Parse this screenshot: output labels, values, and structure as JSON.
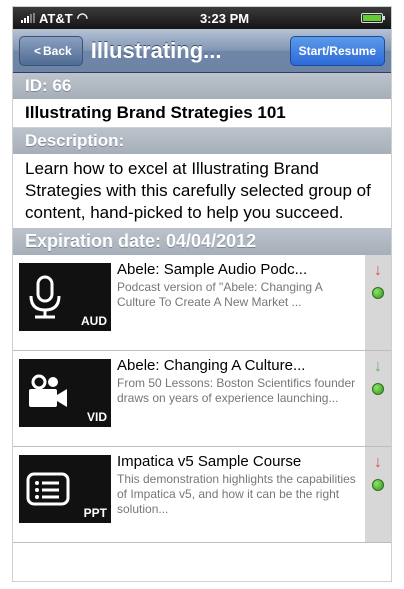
{
  "status_bar": {
    "carrier": "AT&T",
    "time": "3:23 PM"
  },
  "nav": {
    "back_label": "Back",
    "title": "Illustrating...",
    "action_label": "Start/Resume"
  },
  "id_header": "ID: 66",
  "course_title": "Illustrating Brand Strategies 101",
  "description_header": "Description:",
  "description": "Learn how to excel at Illustrating Brand Strategies with this carefully selected group of content, hand-picked to help you succeed.",
  "expiration_header": "Expiration date: 04/04/2012",
  "items": [
    {
      "type": "AUD",
      "icon": "microphone-icon",
      "title": "Abele: Sample Audio Podc...",
      "description": "Podcast version of \"Abele: Changing A Culture To Create A New Market ...",
      "arrow": "↓",
      "arrow_color": "#d9534f",
      "status_color": "#3fae2a"
    },
    {
      "type": "VID",
      "icon": "video-camera-icon",
      "title": "Abele: Changing A Culture...",
      "description": "From 50 Lessons: Boston Scientifics founder draws on years of experience launching...",
      "arrow": "↓",
      "arrow_color": "#5cb85c",
      "status_color": "#3fae2a"
    },
    {
      "type": "PPT",
      "icon": "presentation-icon",
      "title": "Impatica v5 Sample Course",
      "description": "This demonstration highlights the capabilities of Impatica v5, and how it can be the right solution...",
      "arrow": "↓",
      "arrow_color": "#d9534f",
      "status_color": "#3fae2a"
    }
  ]
}
